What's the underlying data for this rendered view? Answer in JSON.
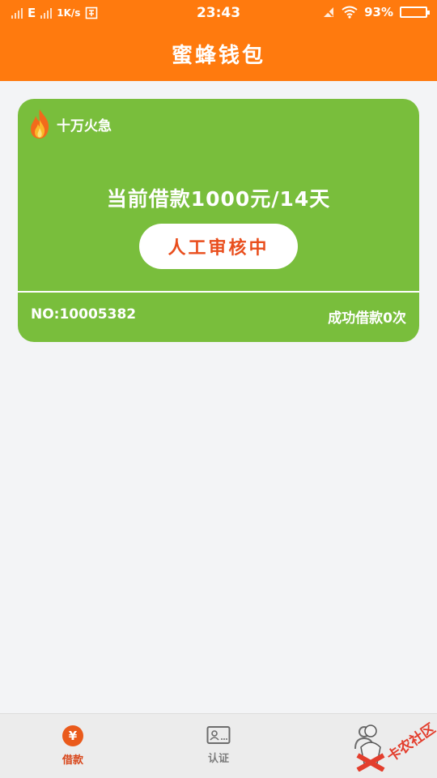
{
  "status_bar": {
    "network": "E",
    "speed": "1K/s",
    "time": "23:43",
    "battery": "93%",
    "battery_level": 0.93
  },
  "header": {
    "title": "蜜蜂钱包"
  },
  "loan_card": {
    "tag": "十万火急",
    "amount_text": "当前借款1000元/14天",
    "status_button": "人工审核中",
    "loan_number": "NO:10005382",
    "success_count": "成功借款0次",
    "background_color": "#79be3c"
  },
  "tab_bar": {
    "tabs": [
      {
        "label": "借款",
        "icon": "yen-icon",
        "active": true
      },
      {
        "label": "认证",
        "icon": "id-card-icon",
        "active": false
      },
      {
        "label": "",
        "icon": "person-icon",
        "active": false
      }
    ]
  },
  "watermark": {
    "text": "卡农社区"
  },
  "colors": {
    "brand_orange": "#ff7a0e",
    "card_green": "#79be3c",
    "accent_red": "#e94e1d"
  }
}
